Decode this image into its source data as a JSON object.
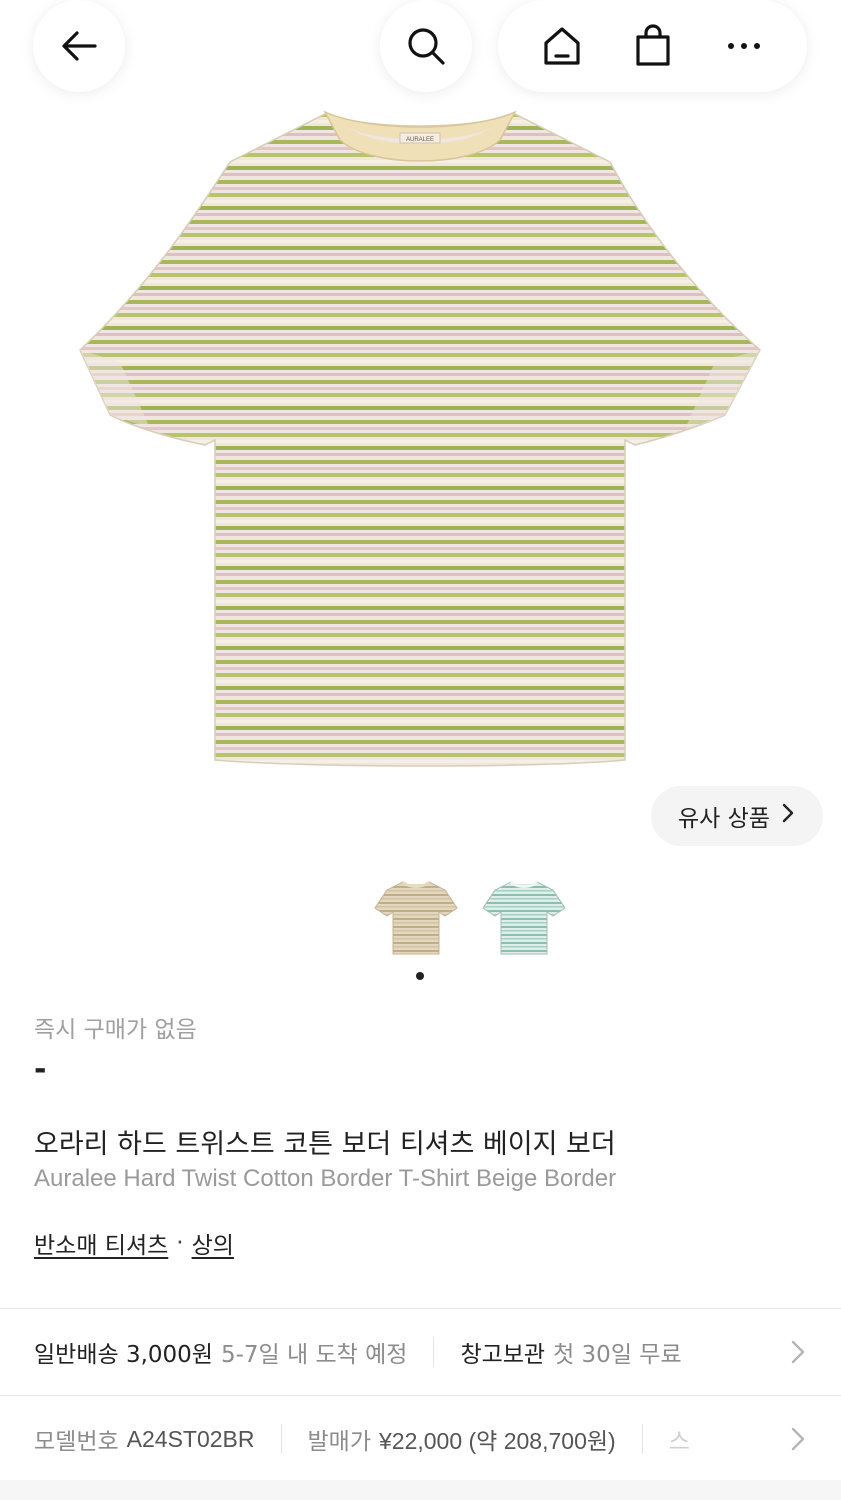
{
  "nav": {
    "back_icon": "arrow-left-icon",
    "search_icon": "search-icon",
    "home_icon": "home-icon",
    "bag_icon": "shopping-bag-icon",
    "more_icon": "more-horizontal-icon"
  },
  "hero": {
    "brand_tag": "AURALEE",
    "colors": {
      "base": "#efe3dc",
      "green": "#a7b75a",
      "pink": "#e5c9c8",
      "collar": "#f0e0b8"
    }
  },
  "similar": {
    "label": "유사 상품"
  },
  "thumbnails": [
    {
      "name": "beige-border",
      "color": "#d9c9a8"
    },
    {
      "name": "green-border",
      "color": "#a9cfc4"
    }
  ],
  "price": {
    "label": "즉시 구매가 없음",
    "value": "-"
  },
  "product": {
    "title_ko": "오라리 하드 트위스트 코튼 보더 티셔츠 베이지 보더",
    "title_en": "Auralee Hard Twist Cotton Border T-Shirt Beige Border",
    "category_1": "반소매 티셔츠",
    "category_sep": "·",
    "category_2": "상의"
  },
  "shipping": {
    "normal_label": "일반배송 3,000원",
    "normal_eta": "5-7일 내 도착 예정",
    "storage_label": "창고보관",
    "storage_value": "첫 30일 무료"
  },
  "details": {
    "model_label": "모델번호",
    "model_value": "A24ST02BR",
    "release_label": "발매가",
    "release_value": "¥22,000 (약 208,700원)",
    "next_fragment": "스"
  }
}
